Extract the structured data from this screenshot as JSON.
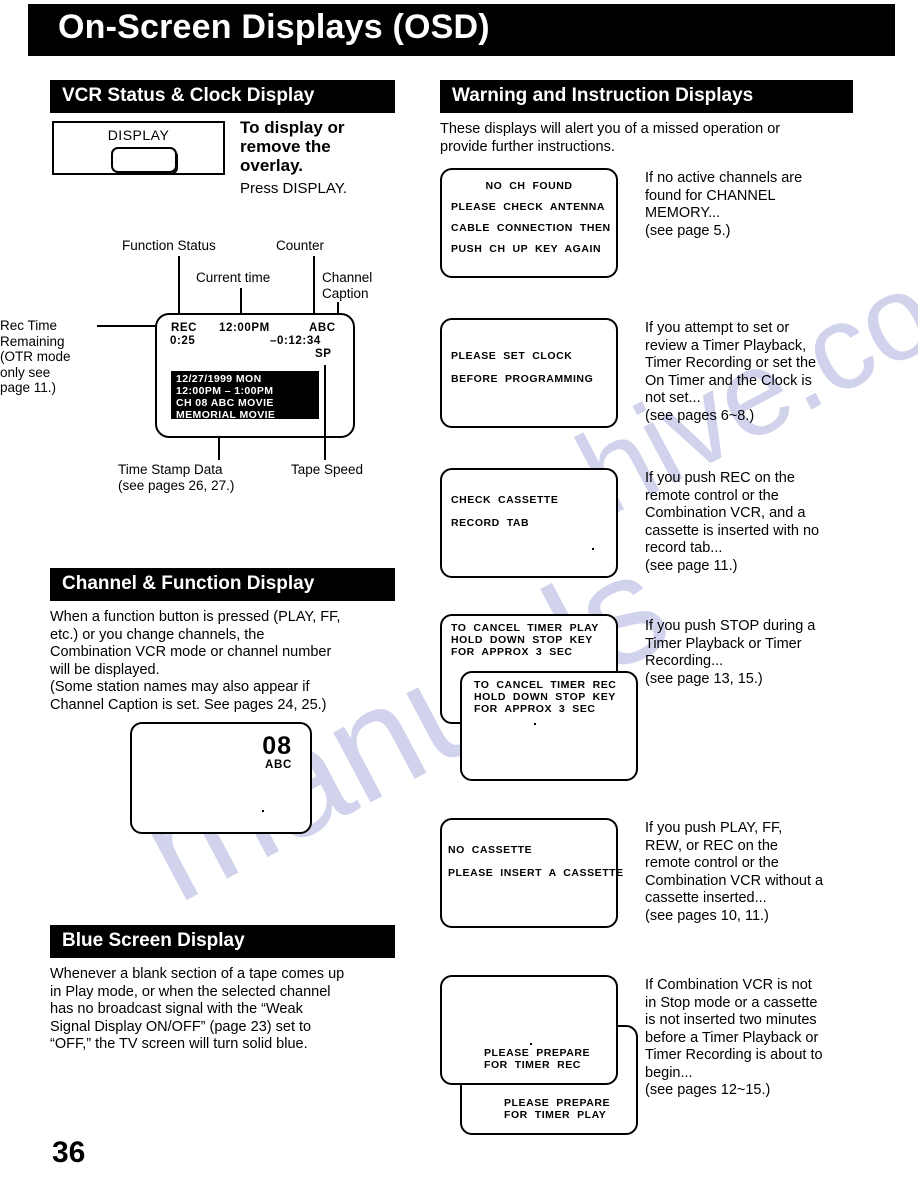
{
  "page": {
    "title": "On-Screen Displays (OSD)",
    "number": "36",
    "watermark_a": "manuals",
    "watermark_b": "hive.com"
  },
  "left_column": {
    "vcr_status_section": {
      "heading": "VCR Status & Clock Display",
      "display_panel": {
        "label": "DISPLAY",
        "button_name": "display-button"
      },
      "callout_strong": "To display or\nremove the\noverlay.",
      "callout_press": "Press DISPLAY.",
      "labels": {
        "function_status": "Function Status",
        "counter": "Counter",
        "current_time": "Current time",
        "channel_caption": "Channel\nCaption",
        "rec_time_remaining": "Rec Time\nRemaining\n(OTR mode\nonly see\npage 11.)",
        "time_stamp_data": "Time Stamp Data\n(see pages 26, 27.)",
        "tape_speed": "Tape Speed"
      },
      "screen": {
        "rec": "REC",
        "current_time": "12:00PM",
        "channel_caption": "ABC",
        "rec_remaining": "0:25",
        "counter": "–0:12:34",
        "tape_speed": "SP",
        "time_stamp": "12/27/1999 MON\n12:00PM –   1:00PM\nCH 08 ABC   MOVIE\nMEMORIAL MOVIE"
      }
    },
    "channel_function_section": {
      "heading": "Channel & Function Display",
      "body": "When a function button is pressed (PLAY, FF,\netc.) or you change channels, the\nCombination VCR mode or channel number\nwill be displayed.\n(Some station names may also appear if\nChannel Caption is set. See pages 24, 25.)",
      "screen": {
        "channel_number": "08",
        "caption": "ABC"
      }
    },
    "blue_screen_section": {
      "heading": "Blue Screen Display",
      "body": "Whenever a blank section of a tape comes up\nin Play mode, or when the selected channel\nhas no broadcast signal with the “Weak\nSignal Display ON/OFF” (page 23) set to\n“OFF,” the TV screen will turn solid blue."
    }
  },
  "right_column": {
    "heading": "Warning and Instruction Displays",
    "intro": "These displays will alert you of a missed operation or\nprovide further instructions.",
    "items": [
      {
        "screen_lines": [
          "NO  CH  FOUND",
          "PLEASE  CHECK  ANTENNA",
          "CABLE  CONNECTION  THEN",
          "PUSH  CH  UP  KEY  AGAIN"
        ],
        "description": "If no active channels are\nfound for CHANNEL\nMEMORY...\n(see page 5.)"
      },
      {
        "screen_lines": [
          "PLEASE  SET  CLOCK",
          "BEFORE  PROGRAMMING"
        ],
        "description": "If you attempt to set or\nreview a Timer Playback,\nTimer Recording or set the\nOn Timer and the Clock is\nnot set...\n(see pages 6~8.)"
      },
      {
        "screen_lines": [
          "CHECK  CASSETTE",
          "RECORD  TAB"
        ],
        "description": "If you push REC on the\nremote control or the\nCombination VCR, and a\ncassette is inserted with no\nrecord tab...\n(see page 11.)"
      },
      {
        "screen_lines_back": [
          "TO  CANCEL  TIMER  PLAY",
          "HOLD  DOWN  STOP  KEY",
          "FOR  APPROX  3  SEC"
        ],
        "screen_lines_front": [
          "TO  CANCEL  TIMER  REC",
          "HOLD  DOWN  STOP  KEY",
          "FOR  APPROX  3  SEC"
        ],
        "description": "If you push STOP during a\nTimer Playback or Timer\nRecording...\n(see page 13, 15.)"
      },
      {
        "screen_lines": [
          "NO  CASSETTE",
          "PLEASE  INSERT  A  CASSETTE"
        ],
        "description": "If you push PLAY, FF,\nREW, or REC on the\nremote control or the\nCombination VCR without a\ncassette inserted...\n(see pages 10, 11.)"
      },
      {
        "screen_lines_back": [
          "PLEASE  PREPARE",
          "FOR  TIMER  REC"
        ],
        "screen_lines_front": [
          "PLEASE  PREPARE",
          "FOR  TIMER  PLAY"
        ],
        "description": "If Combination VCR is not\nin Stop mode or a cassette\nis not inserted two minutes\nbefore a Timer Playback or\nTimer Recording is about to\nbegin...\n(see pages 12~15.)"
      }
    ]
  }
}
